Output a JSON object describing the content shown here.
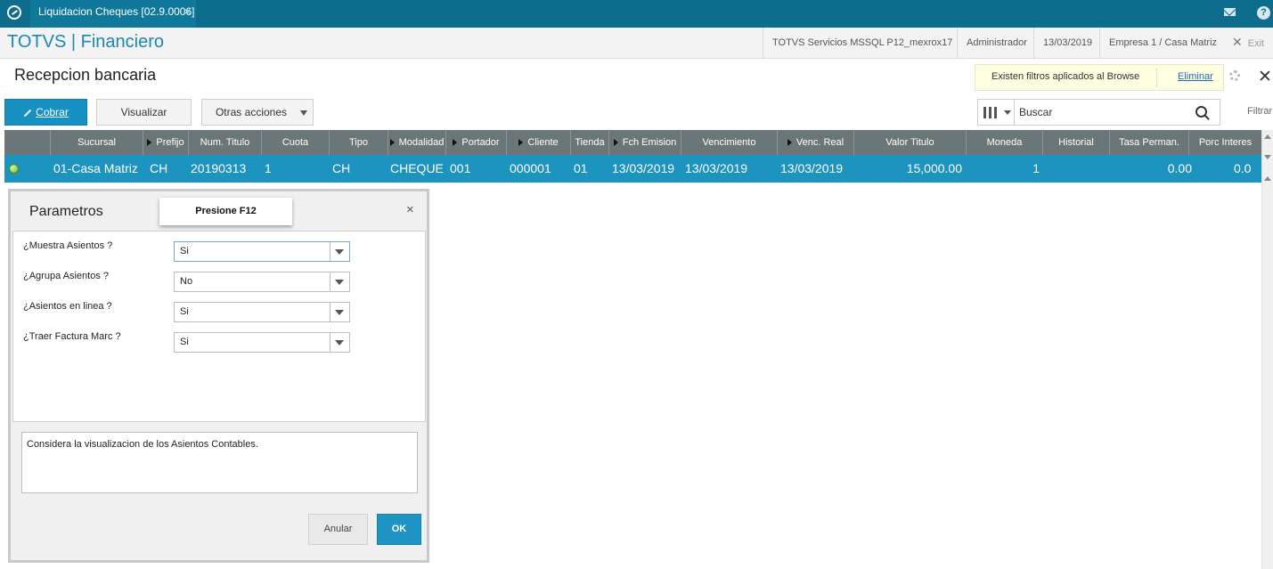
{
  "topbar": {
    "tab_title": "Liquidacion Cheques [02.9.0006]",
    "tab_close": "×"
  },
  "app": {
    "title": "TOTVS | Financiero",
    "environment": "TOTVS Servicios MSSQL P12_mexrox17",
    "user": "Administrador",
    "date": "13/03/2019",
    "company": "Empresa 1 / Casa Matriz",
    "exit_label": "Exit"
  },
  "page": {
    "title": "Recepcion bancaria",
    "filter_notice": "Existen filtros aplicados al Browse",
    "filter_remove": "Eliminar"
  },
  "toolbar": {
    "cobrar": "Cobrar",
    "visualizar": "Visualizar",
    "otras_acciones": "Otras acciones",
    "search_placeholder": "Buscar",
    "filtrar": "Filtrar"
  },
  "grid": {
    "columns": [
      "Sucursal",
      "Prefijo",
      "Num. Titulo",
      "Cuota",
      "Tipo",
      "Modalidad",
      "Portador",
      "Cliente",
      "Tienda",
      "Fch Emision",
      "Vencimiento",
      "Venc. Real",
      "Valor Titulo",
      "Moneda",
      "Historial",
      "Tasa Perman.",
      "Porc Interes"
    ],
    "row": [
      "01-Casa Matriz",
      "CH",
      "20190313",
      "1",
      "CH",
      "CHEQUE",
      "001",
      "000001",
      "01",
      "13/03/2019",
      "13/03/2019",
      "13/03/2019",
      "15,000.00",
      "1",
      "",
      "0.00",
      "0.0"
    ]
  },
  "dialog": {
    "title": "Parametros",
    "hint": "Presione F12",
    "close": "×",
    "params": [
      {
        "label": "¿Muestra Asientos ?",
        "value": "Si"
      },
      {
        "label": "¿Agrupa Asientos ?",
        "value": "No"
      },
      {
        "label": "¿Asientos en linea ?",
        "value": "Si"
      },
      {
        "label": "¿Traer Factura Marc ?",
        "value": "Si"
      }
    ],
    "description": "Considera la visualizacion de los  Asientos Contables.",
    "cancel": "Anular",
    "ok": "OK"
  },
  "colors": {
    "topbar": "#0e6d8c",
    "accent": "#1791c1",
    "selected_row": "#1d93c0",
    "header_row": "#6b7679",
    "title": "#1b87b4"
  }
}
